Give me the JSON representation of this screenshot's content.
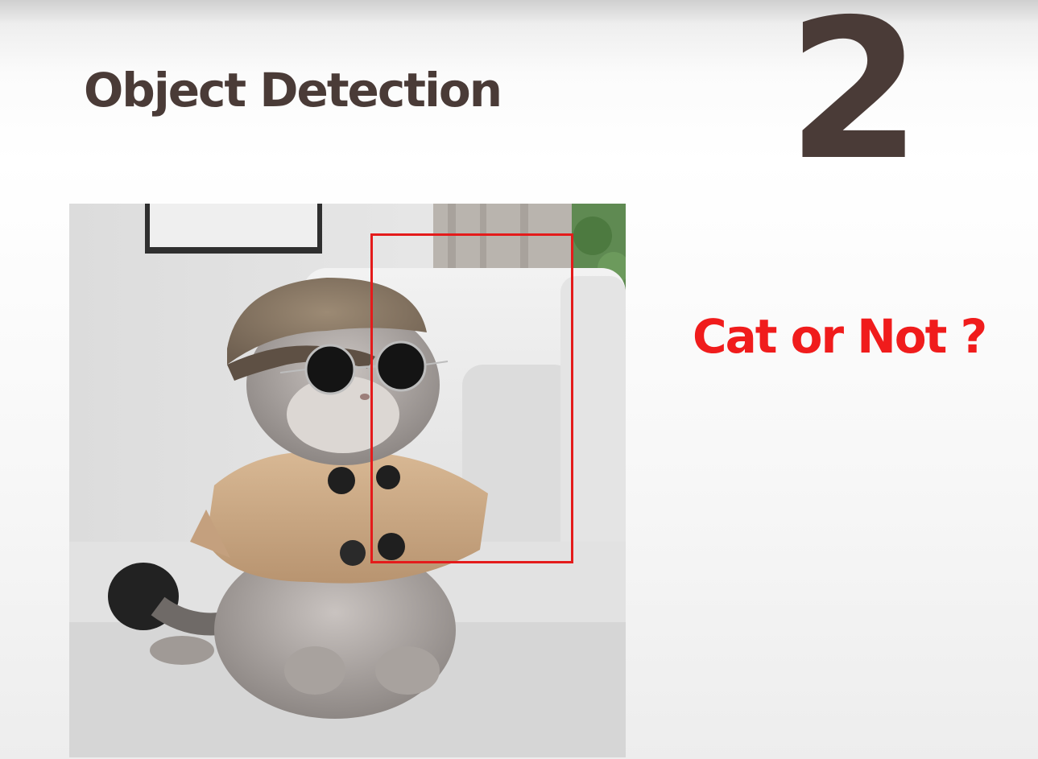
{
  "slide": {
    "title": "Object Detection",
    "number": "2",
    "question": "Cat or Not ?"
  },
  "photo": {
    "subject": "cat-in-hat-sunglasses-and-coat-photo",
    "bounding_box_color": "#e41b1b"
  },
  "colors": {
    "title": "#4a3b37",
    "number": "#4a3b37",
    "question": "#f01c1c",
    "background": "#ffffff"
  }
}
